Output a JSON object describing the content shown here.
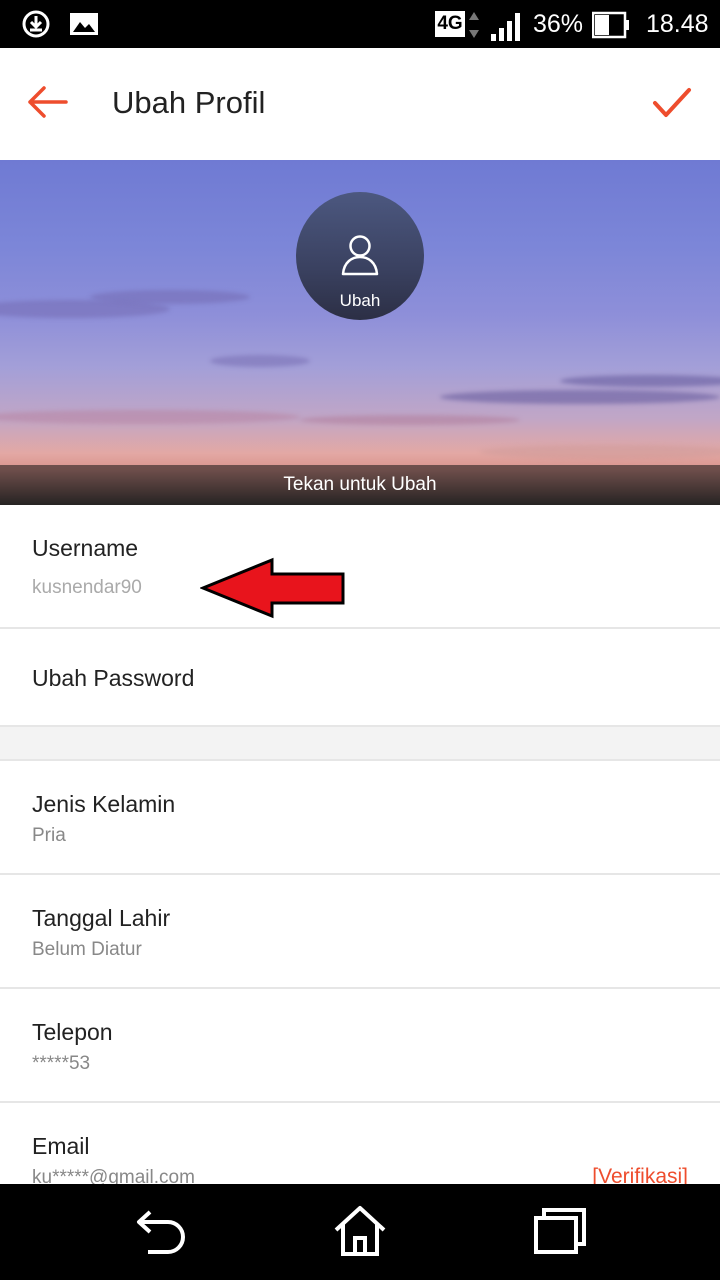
{
  "status_bar": {
    "network": "4G",
    "battery_percent": "36%",
    "time": "18.48",
    "icons": [
      "download-icon",
      "image-icon",
      "signal-icon",
      "battery-icon"
    ]
  },
  "header": {
    "title": "Ubah Profil",
    "back_icon": "back-arrow-icon",
    "confirm_icon": "check-icon"
  },
  "cover": {
    "avatar_label": "Ubah",
    "hint": "Tekan untuk Ubah"
  },
  "fields": {
    "username": {
      "label": "Username",
      "value": "kusnendar90"
    },
    "password": {
      "label": "Ubah Password"
    },
    "gender": {
      "label": "Jenis Kelamin",
      "value": "Pria"
    },
    "birthdate": {
      "label": "Tanggal Lahir",
      "value": "Belum Diatur"
    },
    "phone": {
      "label": "Telepon",
      "value": "*****53"
    },
    "email": {
      "label": "Email",
      "value": "ku*****@gmail.com",
      "action": "[Verifikasi]"
    }
  },
  "colors": {
    "accent": "#ee4d2d",
    "annotation_arrow": "#e8141c"
  }
}
